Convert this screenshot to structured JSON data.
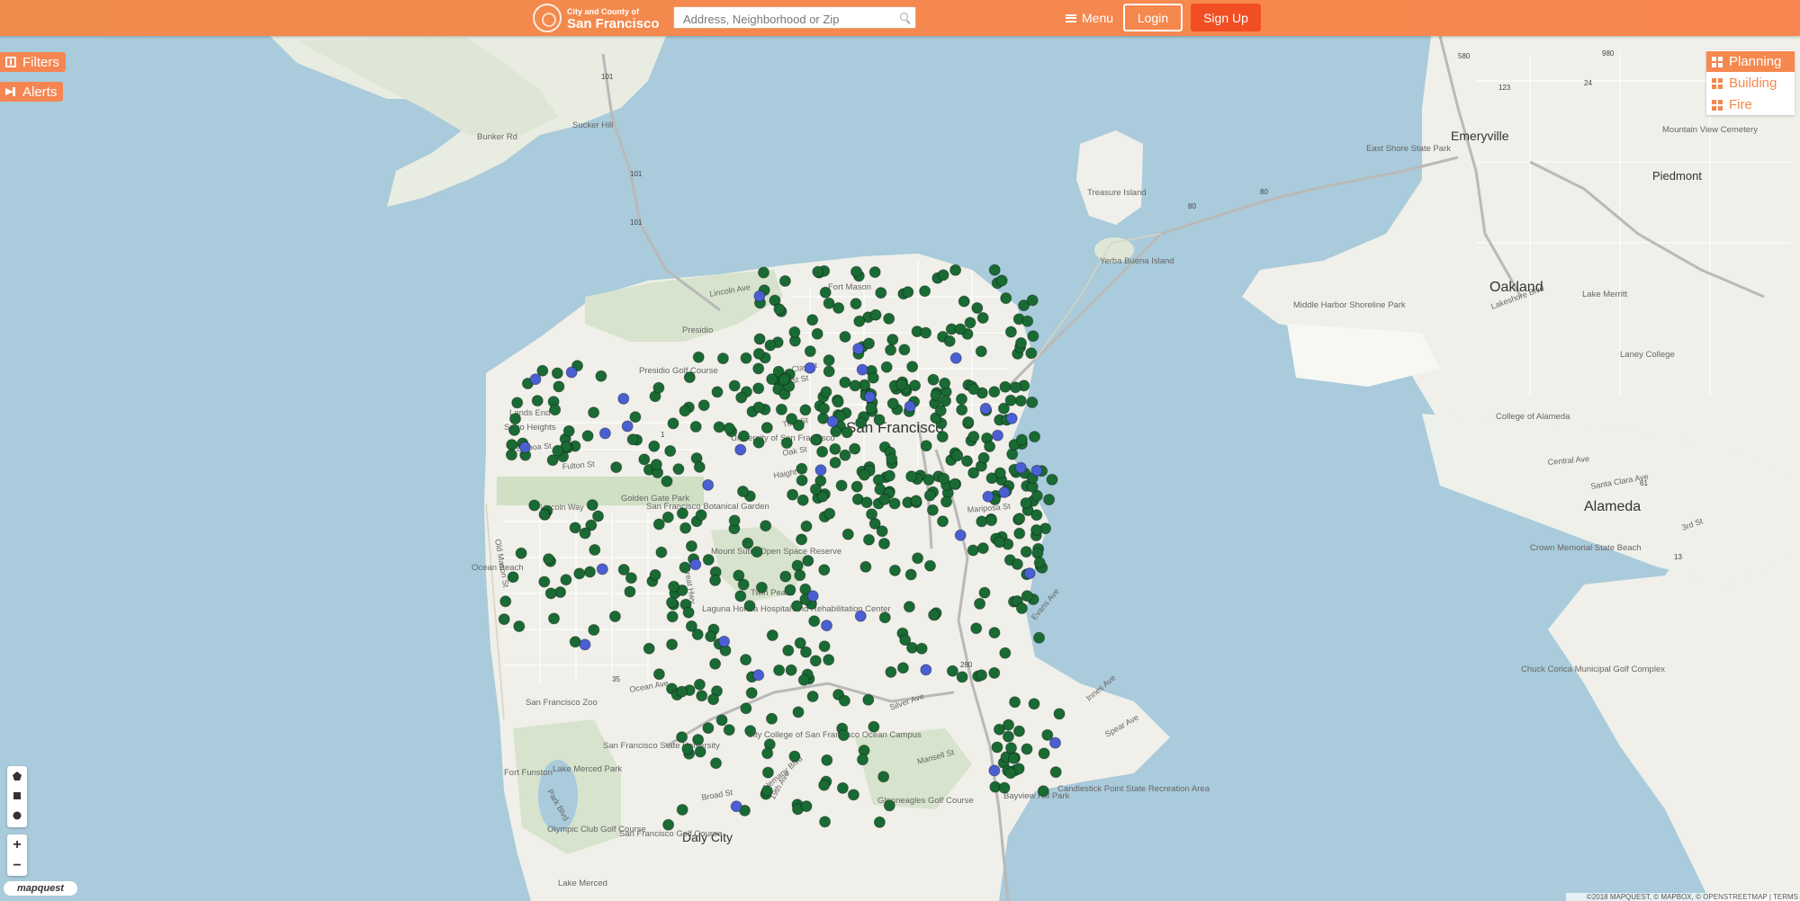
{
  "header": {
    "logo_small": "City and County of",
    "logo_big": "San Francisco",
    "search_placeholder": "Address, Neighborhood or Zip",
    "menu_label": "Menu",
    "login_label": "Login",
    "signup_label": "Sign Up",
    "colors": {
      "bar": "#f5884e",
      "signup": "#f24e24"
    }
  },
  "left_buttons": {
    "filters": "Filters",
    "alerts": "Alerts"
  },
  "layers": [
    {
      "label": "Planning",
      "active": true
    },
    {
      "label": "Building",
      "active": false
    },
    {
      "label": "Fire",
      "active": false
    }
  ],
  "draw_tools": [
    "polygon-tool-icon",
    "rectangle-tool-icon",
    "circle-tool-icon"
  ],
  "zoom": {
    "in": "+",
    "out": "−"
  },
  "map_logo": "mapquest",
  "attribution": "©2018 MAPQUEST, © MAPBOX, © OPENSTREETMAP | TERMS",
  "map_labels": {
    "cities": [
      "San Francisco",
      "Oakland",
      "Alameda",
      "Emeryville",
      "Piedmont",
      "Daly City"
    ],
    "places": [
      "Treasure Island",
      "Yerba Buena Island",
      "Presidio",
      "University of San Francisco",
      "Golden Gate Park",
      "San Francisco Botanical Garden",
      "Mount Sutro Open Space Reserve",
      "Twin Peaks",
      "Laguna Honda Hospital And Rehabilitation Center",
      "City College of San Francisco Ocean Campus",
      "San Francisco State University",
      "San Francisco Zoo",
      "Lake Merced Park",
      "Olympic Club Golf Course",
      "San Francisco Golf Course",
      "Glenneagles Golf Course",
      "Bayview Hill Park",
      "Candlestick Point State Recreation Area",
      "Presidio Golf Course",
      "Lands End",
      "Sutro Heights",
      "Ocean Beach",
      "Fort Funston",
      "Fort Mason",
      "Middle Harbor Shoreline Park",
      "College of Alameda",
      "Chuck Corica Municipal Golf Complex",
      "Lake Merritt",
      "Laney College",
      "Mountain View Cemetery",
      "East Shore State Park",
      "Crown Memorial State Beach",
      "Lake Merced",
      "Sucker Hill",
      "Bunker Rd"
    ],
    "streets": [
      "Fulton St",
      "Balboa St",
      "Oak St",
      "Haight St",
      "Turk St",
      "Post St",
      "Clay St",
      "Lincoln Way",
      "Ocean Ave",
      "Silver Ave",
      "Mansell St",
      "Broad St",
      "Alemany Blvd",
      "Evans Ave",
      "Innes Ave",
      "Spear Ave",
      "Mariposa St",
      "Old Mason St",
      "Great Hwy",
      "19th Ave",
      "Park Blvd",
      "Lakeshore Blvd",
      "3rd St",
      "Central Ave",
      "Santa Clara Ave",
      "Lincoln Ave"
    ],
    "highways": [
      "101",
      "1",
      "80",
      "280",
      "35",
      "580",
      "880",
      "980",
      "24",
      "123",
      "61",
      "13"
    ]
  },
  "markers": {
    "green": "#1a6a34",
    "blue": "#4a5fd1",
    "green_count": 560,
    "blue_count": 38
  }
}
